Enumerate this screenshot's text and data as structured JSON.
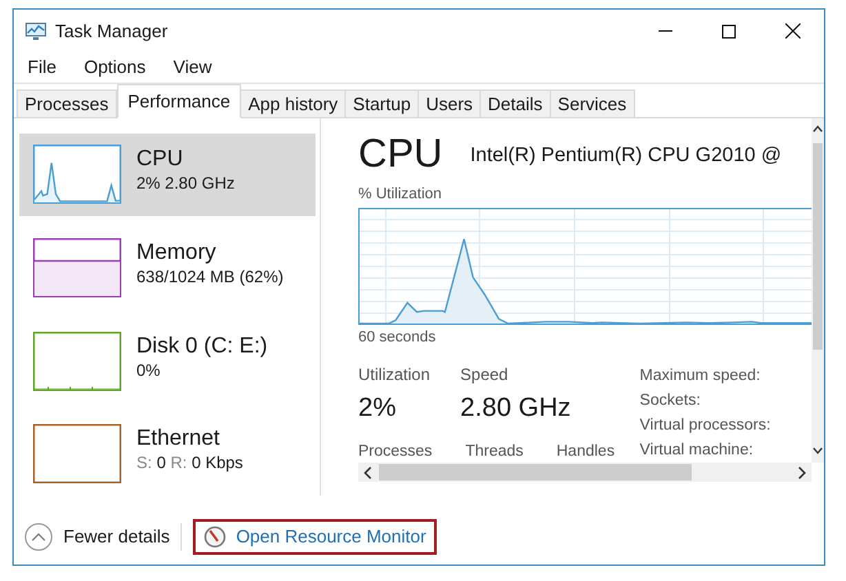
{
  "window": {
    "title": "Task Manager"
  },
  "menu": [
    "File",
    "Options",
    "View"
  ],
  "tabs": [
    {
      "label": "Processes",
      "selected": false
    },
    {
      "label": "Performance",
      "selected": true
    },
    {
      "label": "App history",
      "selected": false
    },
    {
      "label": "Startup",
      "selected": false
    },
    {
      "label": "Users",
      "selected": false
    },
    {
      "label": "Details",
      "selected": false
    },
    {
      "label": "Services",
      "selected": false
    }
  ],
  "sidebar": {
    "items": [
      {
        "kind": "cpu",
        "name": "CPU",
        "detail": [
          {
            "text": "2% 2.80 GHz",
            "dim": false
          }
        ],
        "selected": true,
        "color": "#4a9ed6"
      },
      {
        "kind": "memory",
        "name": "Memory",
        "detail": [
          {
            "text": "638/1024 MB (62%)",
            "dim": false
          }
        ],
        "selected": false,
        "color": "#9b3fb5"
      },
      {
        "kind": "disk",
        "name": "Disk 0 (C: E:)",
        "detail": [
          {
            "text": "0%",
            "dim": false
          }
        ],
        "selected": false,
        "color": "#5ea52a"
      },
      {
        "kind": "ethernet",
        "name": "Ethernet",
        "detail": [
          {
            "text": "S:",
            "dim": true
          },
          {
            "text": "0",
            "dim": false
          },
          {
            "text": "R:",
            "dim": true
          },
          {
            "text": "0 Kbps",
            "dim": false
          }
        ],
        "selected": false,
        "color": "#a7622a"
      }
    ]
  },
  "detail": {
    "title": "CPU",
    "model": "Intel(R) Pentium(R) CPU G2010 @",
    "graph_label": "% Utilization",
    "graph_time": "60 seconds",
    "stats": [
      {
        "label": "Utilization",
        "value": "2%"
      },
      {
        "label": "Speed",
        "value": "2.80 GHz"
      }
    ],
    "counters": [
      "Processes",
      "Threads",
      "Handles"
    ],
    "info_labels": [
      "Maximum speed:",
      "Sockets:",
      "Virtual processors:",
      "Virtual machine:"
    ]
  },
  "footer": {
    "fewer_details": "Fewer details",
    "resource_monitor": {
      "label": "Open Resource Monitor",
      "highlighted": true
    }
  }
}
